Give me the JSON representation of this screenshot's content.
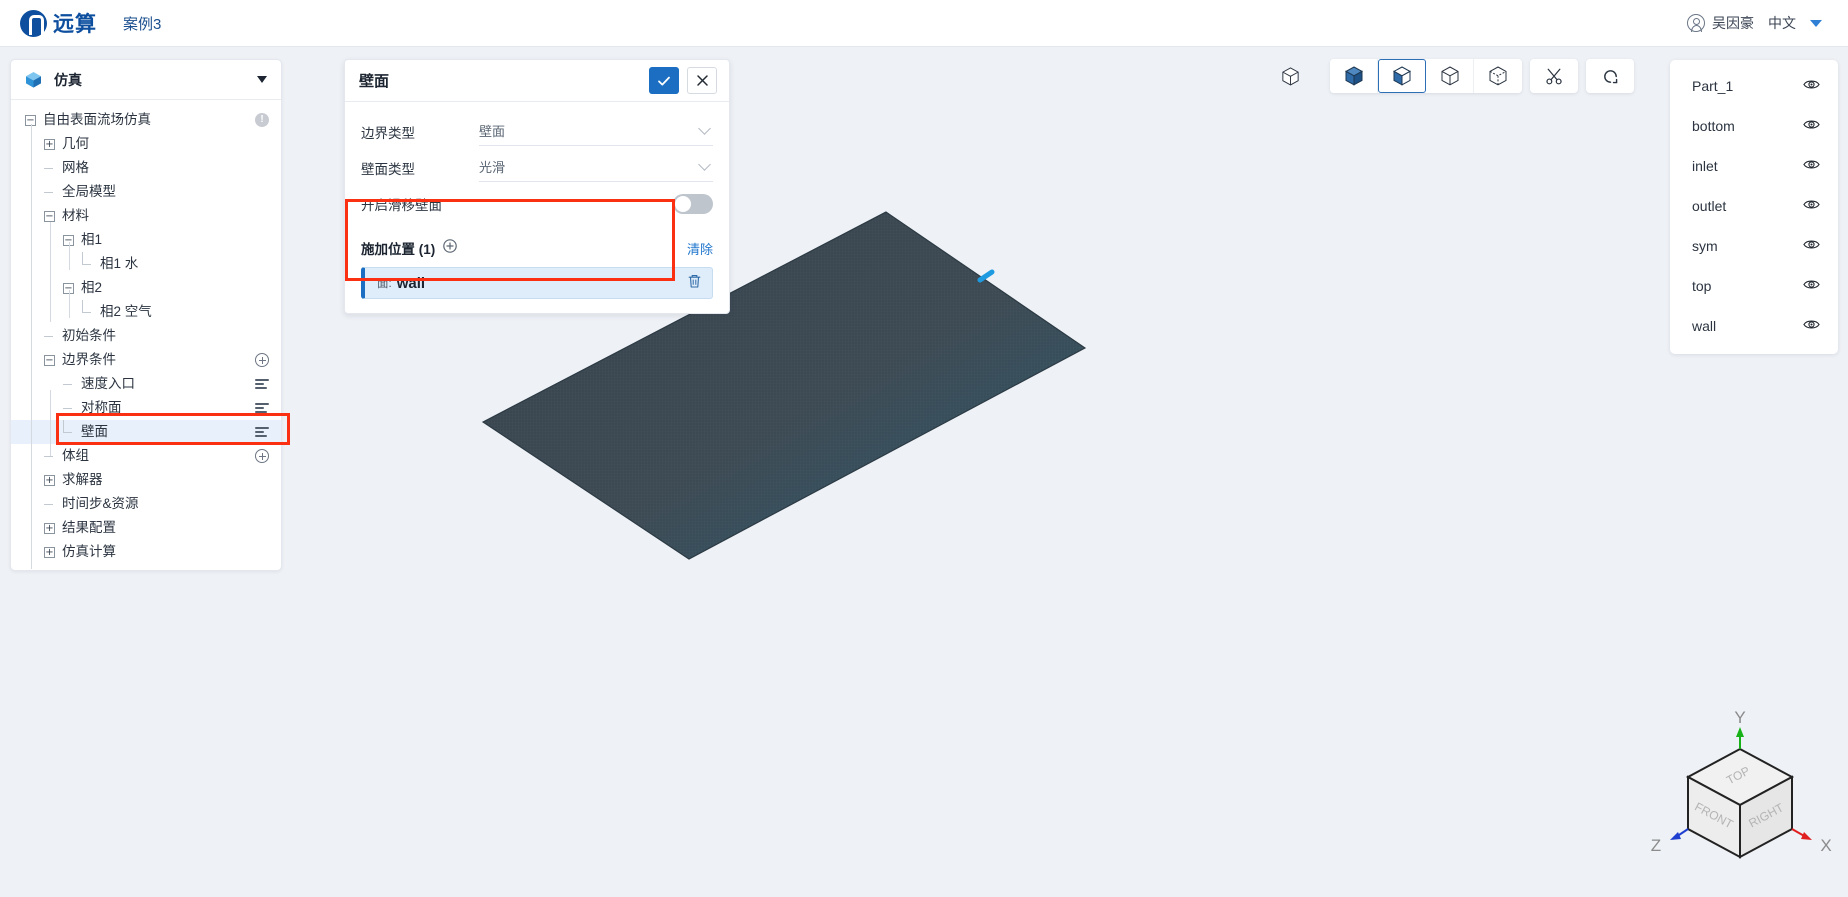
{
  "header": {
    "brand": "远算",
    "case_title": "案例3",
    "user_name": "吴因豪",
    "language": "中文",
    "user_icon": "avatar-icon",
    "caret_icon": "chevron-down-icon"
  },
  "tree_panel": {
    "head_title": "仿真",
    "head_icon": "cube-icon",
    "head_caret": "chevron-down-icon",
    "nodes": [
      {
        "label": "自由表面流场仿真",
        "depth": 0,
        "toggle": "minus",
        "right": "info",
        "selected": false
      },
      {
        "label": "几何",
        "depth": 1,
        "toggle": "plus",
        "right": "",
        "selected": false
      },
      {
        "label": "网格",
        "depth": 1,
        "toggle": "stub",
        "right": "",
        "selected": false
      },
      {
        "label": "全局模型",
        "depth": 1,
        "toggle": "stub",
        "right": "",
        "selected": false
      },
      {
        "label": "材料",
        "depth": 1,
        "toggle": "minus",
        "right": "",
        "selected": false
      },
      {
        "label": "相1",
        "depth": 2,
        "toggle": "minus",
        "right": "",
        "selected": false
      },
      {
        "label": "相1 水",
        "depth": 3,
        "toggle": "elbow",
        "right": "",
        "selected": false
      },
      {
        "label": "相2",
        "depth": 2,
        "toggle": "minus",
        "right": "",
        "selected": false
      },
      {
        "label": "相2 空气",
        "depth": 3,
        "toggle": "elbow",
        "right": "",
        "selected": false
      },
      {
        "label": "初始条件",
        "depth": 1,
        "toggle": "stub",
        "right": "",
        "selected": false
      },
      {
        "label": "边界条件",
        "depth": 1,
        "toggle": "minus",
        "right": "plus",
        "selected": false
      },
      {
        "label": "速度入口",
        "depth": 2,
        "toggle": "stub",
        "right": "list",
        "selected": false
      },
      {
        "label": "对称面",
        "depth": 2,
        "toggle": "stub",
        "right": "list",
        "selected": false
      },
      {
        "label": "壁面",
        "depth": 2,
        "toggle": "elbow",
        "right": "list",
        "selected": true
      },
      {
        "label": "体组",
        "depth": 1,
        "toggle": "stub",
        "right": "plus",
        "selected": false
      },
      {
        "label": "求解器",
        "depth": 1,
        "toggle": "plus",
        "right": "",
        "selected": false
      },
      {
        "label": "时间步&资源",
        "depth": 1,
        "toggle": "stub",
        "right": "",
        "selected": false
      },
      {
        "label": "结果配置",
        "depth": 1,
        "toggle": "plus",
        "right": "",
        "selected": false
      },
      {
        "label": "仿真计算",
        "depth": 1,
        "toggle": "plus",
        "right": "",
        "selected": false
      }
    ]
  },
  "properties": {
    "title": "壁面",
    "confirm_icon": "check-icon",
    "cancel_icon": "close-icon",
    "fields": [
      {
        "label": "边界类型",
        "value": "壁面",
        "control": "select"
      },
      {
        "label": "壁面类型",
        "value": "光滑",
        "control": "select"
      },
      {
        "label": "开启滑移壁面",
        "value": "",
        "control": "toggle",
        "toggle_on": false
      }
    ],
    "attach": {
      "title": "施加位置 (1)",
      "add_icon": "plus-circle-icon",
      "clear_label": "清除",
      "items": [
        {
          "prefix": "面:",
          "name": "wall",
          "delete_icon": "trash-icon"
        }
      ]
    }
  },
  "toolbar": {
    "buttons": [
      {
        "name": "cube-outline-loose",
        "icon": "cube-wire-icon",
        "active": false,
        "group": "loose"
      },
      {
        "name": "cube-solid",
        "icon": "cube-solid-icon",
        "active": false,
        "group": "a"
      },
      {
        "name": "cube-half-solid",
        "icon": "cube-half-icon",
        "active": true,
        "group": "a"
      },
      {
        "name": "cube-wire",
        "icon": "cube-wire-icon",
        "active": false,
        "group": "a"
      },
      {
        "name": "cube-points",
        "icon": "cube-points-icon",
        "active": false,
        "group": "a"
      },
      {
        "name": "clip-tool",
        "icon": "scissors-icon",
        "active": false,
        "group": "single"
      },
      {
        "name": "reset-view",
        "icon": "refresh-icon",
        "active": false,
        "group": "single"
      }
    ]
  },
  "parts_panel": {
    "visibility_icon": "eye-icon",
    "items": [
      {
        "label": "Part_1",
        "visible": true
      },
      {
        "label": "bottom",
        "visible": true
      },
      {
        "label": "inlet",
        "visible": true
      },
      {
        "label": "outlet",
        "visible": true
      },
      {
        "label": "sym",
        "visible": true
      },
      {
        "label": "top",
        "visible": true
      },
      {
        "label": "wall",
        "visible": true
      }
    ]
  },
  "gizmo": {
    "axis_x": "X",
    "axis_y": "Y",
    "axis_z": "Z",
    "face_top": "TOP",
    "face_front": "FRONT",
    "face_right": "RIGHT",
    "color_x": "#e02020",
    "color_y": "#18b218",
    "color_z": "#1f3fd0"
  },
  "viewport": {
    "model_name": "wall-surface-plate",
    "model_color": "#3a4450",
    "model_accent": "#2d5f77",
    "highlight_color": "#1e9ae0",
    "background": "#eef1f5"
  },
  "annotations": {
    "highlight_color": "#fb2f12",
    "boxes": [
      {
        "name": "attach-position-highlight"
      },
      {
        "name": "tree-wall-node-highlight"
      }
    ]
  }
}
